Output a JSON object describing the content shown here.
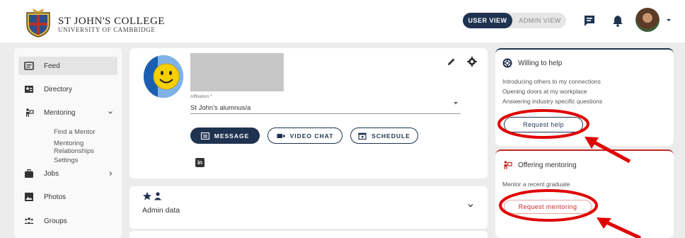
{
  "header": {
    "brand_name": "ST JOHN'S COLLEGE",
    "brand_sub": "UNIVERSITY OF CAMBRIDGE",
    "view_user": "USER VIEW",
    "view_admin": "ADMIN VIEW"
  },
  "sidebar": {
    "items": [
      {
        "label": "Feed",
        "icon": "feed-icon"
      },
      {
        "label": "Directory",
        "icon": "directory-icon"
      },
      {
        "label": "Mentoring",
        "icon": "mentoring-icon"
      },
      {
        "label": "Jobs",
        "icon": "jobs-icon"
      },
      {
        "label": "Photos",
        "icon": "photos-icon"
      },
      {
        "label": "Groups",
        "icon": "groups-icon"
      }
    ],
    "mentoring_sub": [
      "Find a Mentor",
      "Mentoring Relationships",
      "Settings"
    ]
  },
  "profile": {
    "affiliation_label": "Affiliation *",
    "affiliation_value": "St John's alumnus/a",
    "buttons": {
      "message": "MESSAGE",
      "video_chat": "VIDEO CHAT",
      "schedule": "SCHEDULE"
    },
    "linkedin": "in"
  },
  "admin": {
    "label": "Admin data"
  },
  "help": {
    "title": "Willing to help",
    "lines": [
      "Introducing others to my connections",
      "Opening doors at my workplace",
      "Answering industry specific questions"
    ],
    "button": "Request help"
  },
  "mentoring": {
    "title": "Offering mentoring",
    "line": "Mentor a recent graduate",
    "button": "Request mentoring"
  },
  "colors": {
    "navy": "#1f3350",
    "red": "#c62828",
    "annotation": "#e00000"
  }
}
